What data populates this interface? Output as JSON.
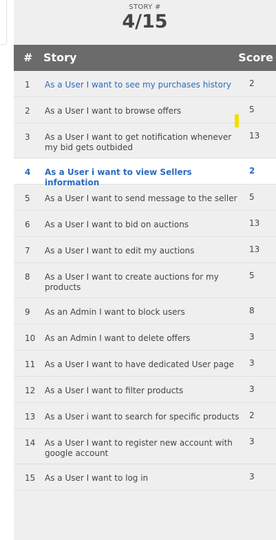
{
  "header": {
    "caption": "STORY #",
    "progress": "4/15"
  },
  "table": {
    "columns": {
      "num": "#",
      "story": "Story",
      "score": "Score"
    },
    "rows": [
      {
        "num": "1",
        "story": "As a User I want to see my purchases history",
        "score": "2"
      },
      {
        "num": "2",
        "story": "As a User I want to browse offers",
        "score": "5"
      },
      {
        "num": "3",
        "story": "As a User I want to get notification whenever my bid gets outbided",
        "score": "13"
      },
      {
        "num": "4",
        "story": "As a User i want to view Sellers information",
        "score": "2"
      },
      {
        "num": "5",
        "story": "As a User I want to send message to the seller",
        "score": "5"
      },
      {
        "num": "6",
        "story": "As a User I want to bid on auctions",
        "score": "13"
      },
      {
        "num": "7",
        "story": "As a User I want to edit my auctions",
        "score": "13"
      },
      {
        "num": "8",
        "story": "As a User I want to create auctions for my products",
        "score": "5"
      },
      {
        "num": "9",
        "story": "As an Admin I want to block users",
        "score": "8"
      },
      {
        "num": "10",
        "story": "As an Admin I want to delete offers",
        "score": "3"
      },
      {
        "num": "11",
        "story": "As a User I want to have dedicated User page",
        "score": "3"
      },
      {
        "num": "12",
        "story": "As a User I want to filter products",
        "score": "3"
      },
      {
        "num": "13",
        "story": "As a User i want to search for specific products",
        "score": "2"
      },
      {
        "num": "14",
        "story": "As a User I want to register new account with google account",
        "score": "3"
      },
      {
        "num": "15",
        "story": "As a User I want to log in",
        "score": "3"
      }
    ]
  },
  "colors": {
    "link": "#2b6bbf",
    "header_bg": "#6b6b6b",
    "panel_bg": "#efefef",
    "marker": "#f1e000"
  }
}
